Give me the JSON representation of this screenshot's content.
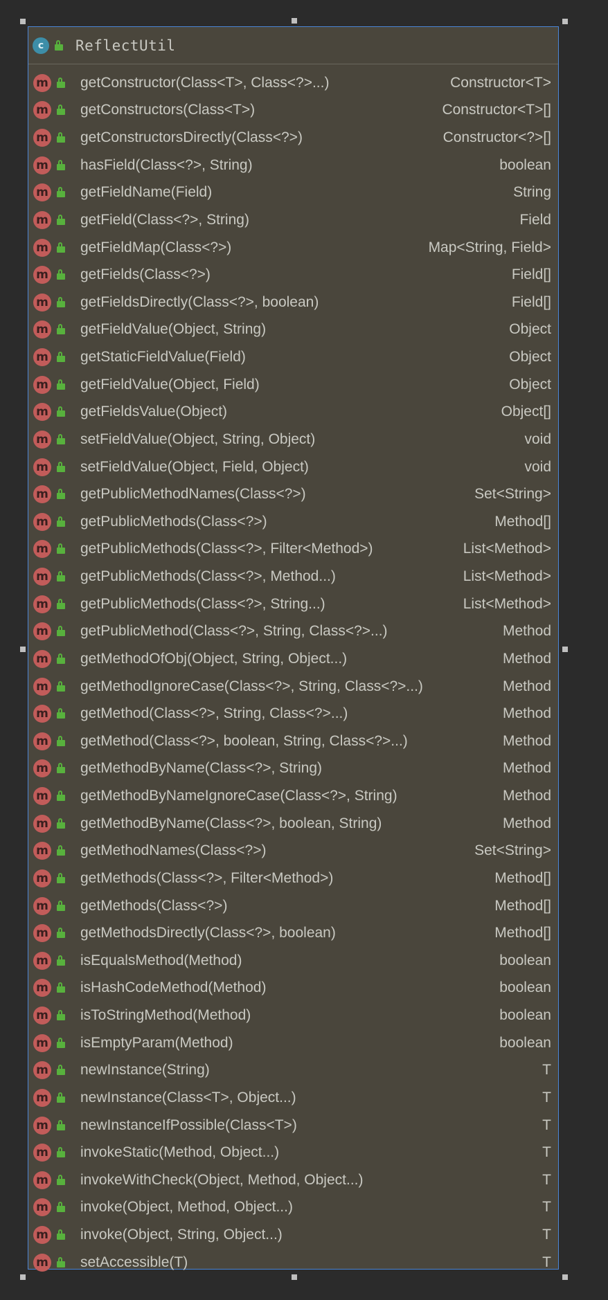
{
  "class": {
    "name": "ReflectUtil",
    "icon_letter": "c",
    "icon": "class-icon",
    "visibility_icon": "lock-open-icon"
  },
  "method_icon_letter": "m",
  "methods": [
    {
      "signature": "getConstructor(Class<T>, Class<?>...)",
      "returns": "Constructor<T>"
    },
    {
      "signature": "getConstructors(Class<T>)",
      "returns": "Constructor<T>[]"
    },
    {
      "signature": "getConstructorsDirectly(Class<?>)",
      "returns": "Constructor<?>[]"
    },
    {
      "signature": "hasField(Class<?>, String)",
      "returns": "boolean"
    },
    {
      "signature": "getFieldName(Field)",
      "returns": "String"
    },
    {
      "signature": "getField(Class<?>, String)",
      "returns": "Field"
    },
    {
      "signature": "getFieldMap(Class<?>)",
      "returns": "Map<String, Field>"
    },
    {
      "signature": "getFields(Class<?>)",
      "returns": "Field[]"
    },
    {
      "signature": "getFieldsDirectly(Class<?>, boolean)",
      "returns": "Field[]"
    },
    {
      "signature": "getFieldValue(Object, String)",
      "returns": "Object"
    },
    {
      "signature": "getStaticFieldValue(Field)",
      "returns": "Object"
    },
    {
      "signature": "getFieldValue(Object, Field)",
      "returns": "Object"
    },
    {
      "signature": "getFieldsValue(Object)",
      "returns": "Object[]"
    },
    {
      "signature": "setFieldValue(Object, String, Object)",
      "returns": "void"
    },
    {
      "signature": "setFieldValue(Object, Field, Object)",
      "returns": "void"
    },
    {
      "signature": "getPublicMethodNames(Class<?>)",
      "returns": "Set<String>"
    },
    {
      "signature": "getPublicMethods(Class<?>)",
      "returns": "Method[]"
    },
    {
      "signature": "getPublicMethods(Class<?>, Filter<Method>)",
      "returns": "List<Method>"
    },
    {
      "signature": "getPublicMethods(Class<?>, Method...)",
      "returns": "List<Method>"
    },
    {
      "signature": "getPublicMethods(Class<?>, String...)",
      "returns": "List<Method>"
    },
    {
      "signature": "getPublicMethod(Class<?>, String, Class<?>...)",
      "returns": "Method"
    },
    {
      "signature": "getMethodOfObj(Object, String, Object...)",
      "returns": "Method"
    },
    {
      "signature": "getMethodIgnoreCase(Class<?>, String, Class<?>...)",
      "returns": "Method"
    },
    {
      "signature": "getMethod(Class<?>, String, Class<?>...)",
      "returns": "Method"
    },
    {
      "signature": "getMethod(Class<?>, boolean, String, Class<?>...)",
      "returns": "Method"
    },
    {
      "signature": "getMethodByName(Class<?>, String)",
      "returns": "Method"
    },
    {
      "signature": "getMethodByNameIgnoreCase(Class<?>, String)",
      "returns": "Method"
    },
    {
      "signature": "getMethodByName(Class<?>, boolean, String)",
      "returns": "Method"
    },
    {
      "signature": "getMethodNames(Class<?>)",
      "returns": "Set<String>"
    },
    {
      "signature": "getMethods(Class<?>, Filter<Method>)",
      "returns": "Method[]"
    },
    {
      "signature": "getMethods(Class<?>)",
      "returns": "Method[]"
    },
    {
      "signature": "getMethodsDirectly(Class<?>, boolean)",
      "returns": "Method[]"
    },
    {
      "signature": "isEqualsMethod(Method)",
      "returns": "boolean"
    },
    {
      "signature": "isHashCodeMethod(Method)",
      "returns": "boolean"
    },
    {
      "signature": "isToStringMethod(Method)",
      "returns": "boolean"
    },
    {
      "signature": "isEmptyParam(Method)",
      "returns": "boolean"
    },
    {
      "signature": "newInstance(String)",
      "returns": "T"
    },
    {
      "signature": "newInstance(Class<T>, Object...)",
      "returns": "T"
    },
    {
      "signature": "newInstanceIfPossible(Class<T>)",
      "returns": "T"
    },
    {
      "signature": "invokeStatic(Method, Object...)",
      "returns": "T"
    },
    {
      "signature": "invokeWithCheck(Object, Method, Object...)",
      "returns": "T"
    },
    {
      "signature": "invoke(Object, Method, Object...)",
      "returns": "T"
    },
    {
      "signature": "invoke(Object, String, Object...)",
      "returns": "T"
    },
    {
      "signature": "setAccessible(T)",
      "returns": "T"
    }
  ]
}
